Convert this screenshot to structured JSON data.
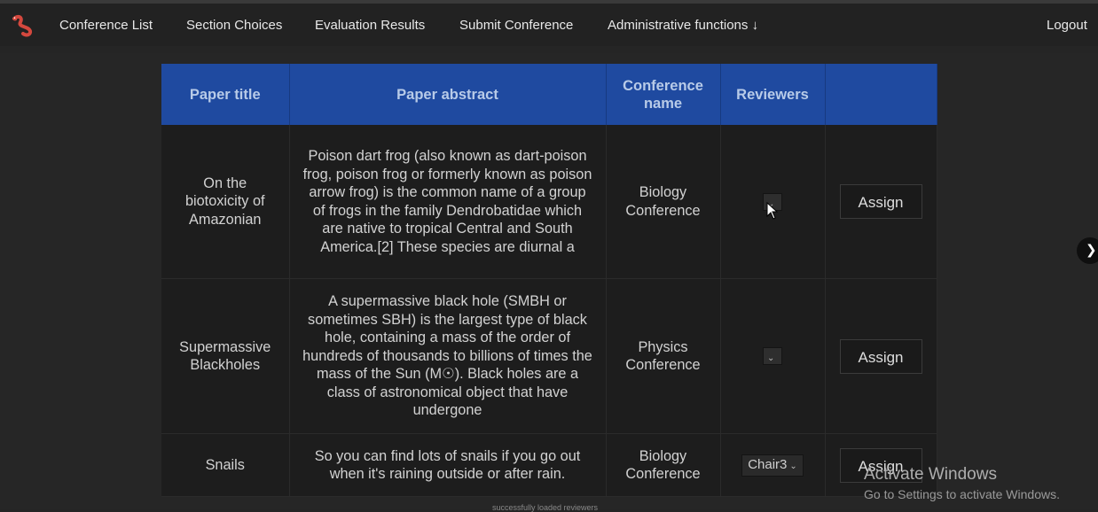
{
  "nav": {
    "items": [
      {
        "label": "Conference List"
      },
      {
        "label": "Section Choices"
      },
      {
        "label": "Evaluation Results"
      },
      {
        "label": "Submit Conference"
      },
      {
        "label": "Administrative functions ↓"
      }
    ],
    "logout": "Logout"
  },
  "table": {
    "headers": [
      "Paper title",
      "Paper abstract",
      "Conference name",
      "Reviewers",
      ""
    ],
    "rows": [
      {
        "title": "On the biotoxicity of Amazonian",
        "abstract": "Poison dart frog (also known as dart-poison frog, poison frog or formerly known as poison arrow frog) is the common name of a group of frogs in the family Dendrobatidae which are native to tropical Central and South America.[2] These species are diurnal a",
        "conference": "Biology Conference",
        "reviewer": "",
        "action": "Assign"
      },
      {
        "title": "Supermassive Blackholes",
        "abstract": "A supermassive black hole (SMBH or sometimes SBH) is the largest type of black hole, containing a mass of the order of hundreds of thousands to billions of times the mass of the Sun (M☉). Black holes are a class of astronomical object that have undergone",
        "conference": "Physics Conference",
        "reviewer": "",
        "action": "Assign"
      },
      {
        "title": "Snails",
        "abstract": "So you can find lots of snails if you go out when it's raining outside or after rain.",
        "conference": "Biology Conference",
        "reviewer": "Chair3",
        "action": "Assign"
      }
    ]
  },
  "status_message": "successfully loaded reviewers",
  "watermark": {
    "line1": "Activate Windows",
    "line2": "Go to Settings to activate Windows."
  },
  "icons": {
    "logo": "worm-logo-icon",
    "dropdown": "chevron-down-icon",
    "side": "chevron-right-icon",
    "cursor": "mouse-pointer-icon"
  },
  "colors": {
    "header_blue": "#1f4aa0",
    "background": "#252525",
    "logo_red": "#d4483e"
  }
}
